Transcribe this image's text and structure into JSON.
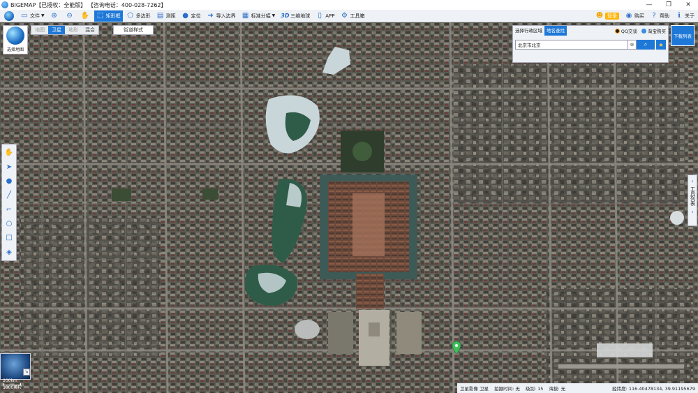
{
  "window": {
    "title": "BIGEMAP【已授权：全能版】 【咨询电话：400-028-7262】",
    "buttons": [
      "—",
      "❐",
      "✕"
    ]
  },
  "toolbar": {
    "items": [
      {
        "id": "file",
        "label": "文件",
        "icon": "folder-icon",
        "caret": true
      },
      {
        "id": "zoom-in",
        "label": "",
        "icon": "zoom-in-icon"
      },
      {
        "id": "zoom-out",
        "label": "",
        "icon": "zoom-out-icon"
      },
      {
        "id": "pan",
        "label": "",
        "icon": "hand-icon"
      },
      {
        "id": "rect-select",
        "label": "矩形框",
        "icon": "rectangle-select-icon",
        "active": true
      },
      {
        "id": "polygon",
        "label": "多边形",
        "icon": "polygon-icon"
      },
      {
        "id": "measure",
        "label": "测距",
        "icon": "ruler-icon"
      },
      {
        "id": "locate",
        "label": "定位",
        "icon": "location-pin-icon"
      },
      {
        "id": "import-boundary",
        "label": "导入边界",
        "icon": "import-icon"
      },
      {
        "id": "grid",
        "label": "标准分幅",
        "icon": "grid-icon",
        "caret": true
      },
      {
        "id": "globe3d",
        "label": "三维地球",
        "icon": "3d-icon"
      },
      {
        "id": "app",
        "label": "APP",
        "icon": "phone-icon"
      },
      {
        "id": "toolbox",
        "label": "工具箱",
        "icon": "gear-icon"
      }
    ],
    "right": {
      "login": "登录",
      "buy": "购买",
      "help": "帮助",
      "about": "关于"
    }
  },
  "map_type": {
    "selector_label": "选择地图",
    "tabs": [
      "地图",
      "卫星",
      "地形",
      "混合"
    ],
    "active_tab": "卫星",
    "street_style": "街道样式"
  },
  "search": {
    "tabs": [
      "选择行政区域",
      "地名查找"
    ],
    "active_tab": "地名查找",
    "qq_label": "QQ交谈",
    "taobao_label": "淘宝购买",
    "value": "北京市北京",
    "clear": "⊗",
    "search_icon": "search-icon",
    "favorite_icon": "star-icon"
  },
  "download_button": "下载列表",
  "right_panel": {
    "label": "工具列表"
  },
  "overview": {
    "scale_top": "200km",
    "scale_bottom": "1000英尺"
  },
  "status": {
    "layer": "卫星影像 卫星",
    "shoot_time": "拍摄时间: 无",
    "level": "级别: 15",
    "altitude": "海拔: 无",
    "coords": "经纬度: 116.40478134, 39.91195679"
  },
  "colors": {
    "accent": "#1e78d7",
    "toolbar_bg": "#eef1f5",
    "water": "#2f5c48",
    "ice": "#c9d6d9"
  }
}
